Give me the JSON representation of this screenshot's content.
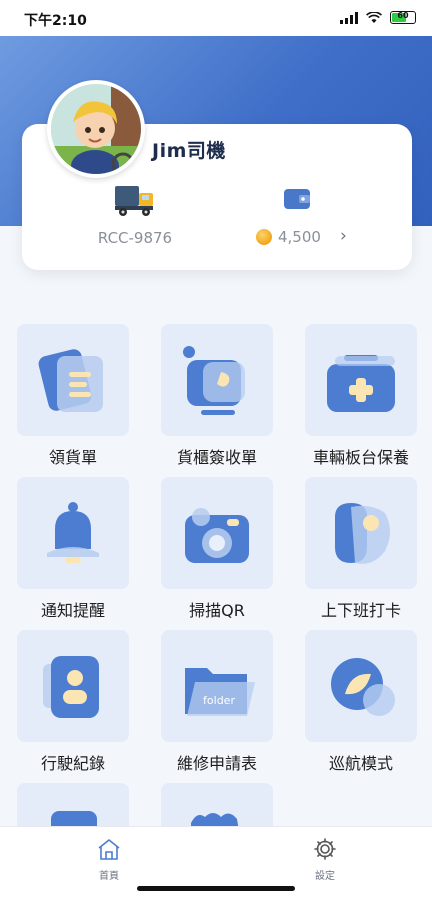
{
  "status_bar": {
    "time": "下午2:10",
    "battery": "60"
  },
  "profile": {
    "name": "Jim司機",
    "plate": "RCC-9876",
    "balance": "4,500",
    "balance_chevron": "›"
  },
  "icons": {
    "vehicle": "truck-icon",
    "wallet": "wallet-icon",
    "coin": "coin-icon"
  },
  "menu": [
    {
      "label": "領貨單",
      "icon": "document-icon"
    },
    {
      "label": "貨櫃簽收單",
      "icon": "monitor-icon"
    },
    {
      "label": "車輛板台保養",
      "icon": "medical-kit-icon"
    },
    {
      "label": "通知提醒",
      "icon": "bell-icon"
    },
    {
      "label": "掃描QR",
      "icon": "camera-icon"
    },
    {
      "label": "上下班打卡",
      "icon": "shield-icon"
    },
    {
      "label": "行駛紀錄",
      "icon": "id-card-icon"
    },
    {
      "label": "維修申請表",
      "icon": "folder-icon",
      "icon_text": "folder"
    },
    {
      "label": "巡航模式",
      "icon": "compass-icon"
    }
  ],
  "bottom_nav": {
    "home": "首頁",
    "settings": "設定"
  },
  "colors": {
    "accent": "#3f6fc8",
    "accent_light": "#e3ecf8",
    "icon_cream": "#fbe6b3"
  }
}
